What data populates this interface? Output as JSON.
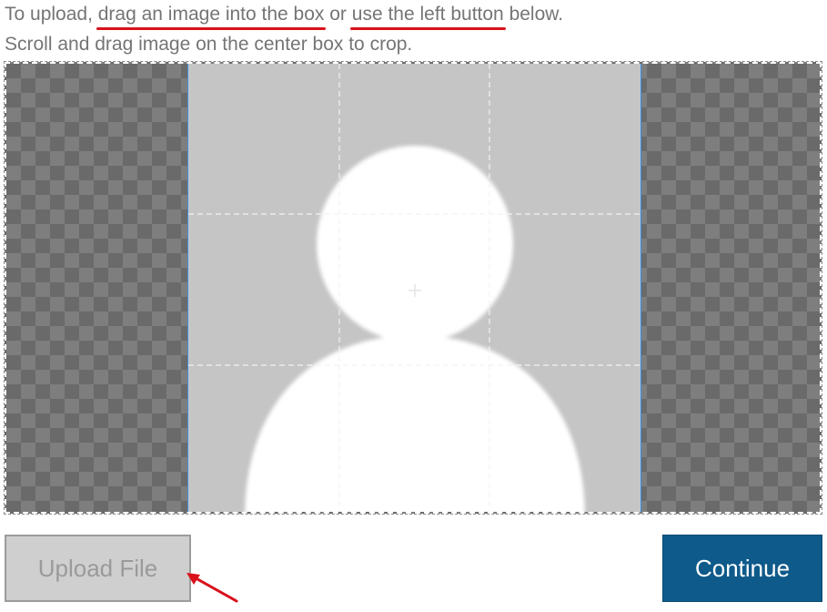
{
  "instructions": {
    "line1_prefix": "To upload, ",
    "line1_link1": "drag an image into the box",
    "line1_middle": " or ",
    "line1_link2": "use the left button",
    "line1_suffix": " below.",
    "line2": "Scroll and drag image on the center box to crop."
  },
  "buttons": {
    "upload_label": "Upload File",
    "continue_label": "Continue"
  },
  "colors": {
    "annotation": "#d9111b",
    "continue_bg": "#0e5a8a",
    "crop_border": "#3d8fe0"
  },
  "icons": {
    "placeholder": "person-silhouette-icon",
    "center_marker": "crosshair-icon",
    "annotation": "arrow-icon"
  }
}
